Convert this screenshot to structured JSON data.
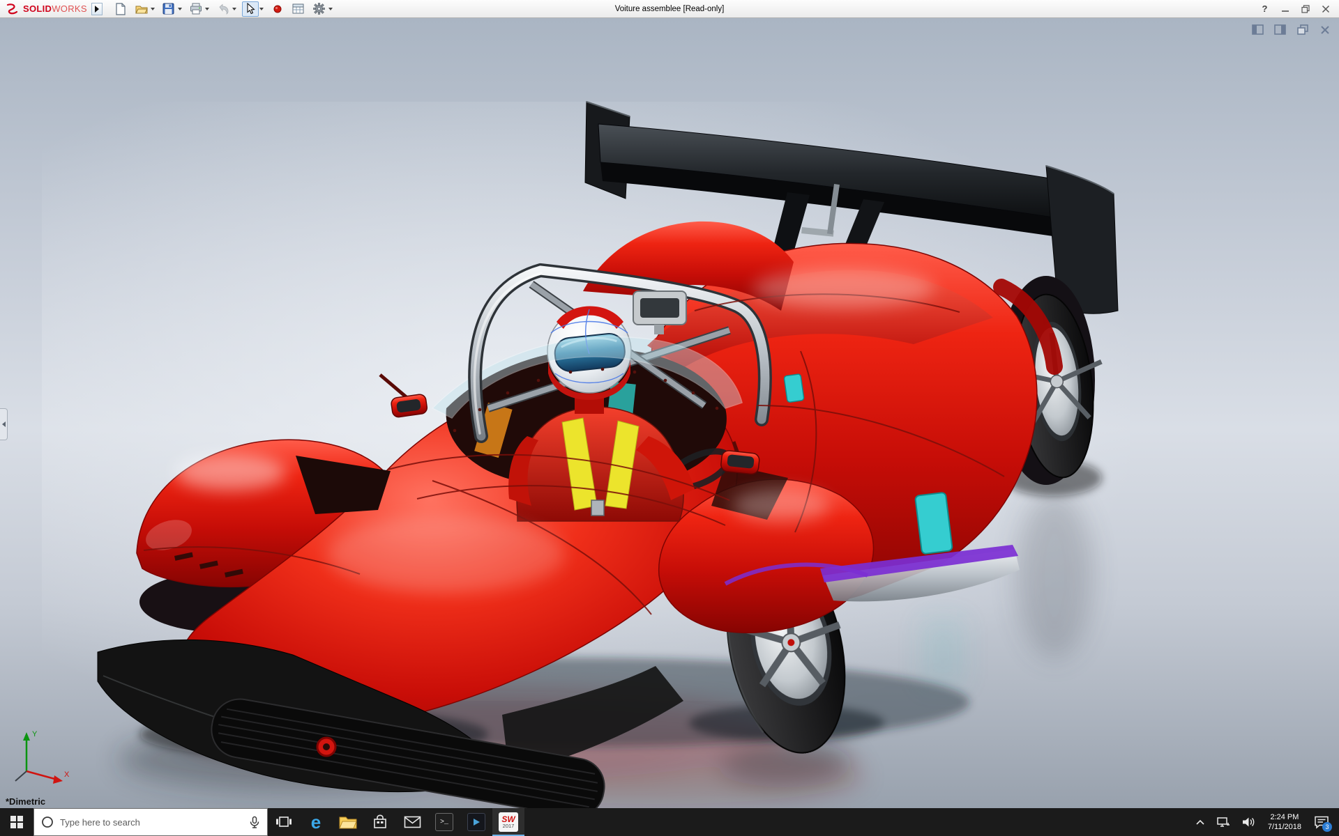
{
  "colors": {
    "accent_red": "#d61310",
    "wing_black": "#141414",
    "accent_cyan": "#35cdd0",
    "accent_purple": "#7b2ed2",
    "harness_yellow": "#ece42c",
    "taskbar_bg": "#1b1b1b",
    "titlebar_bg": "#f2f2f2",
    "active_underline": "#6cb2e8"
  },
  "titlebar": {
    "brand_solid": "SOLID",
    "brand_works": "WORKS",
    "title": "Voiture assemblee [Read-only]",
    "help_glyph": "?",
    "toolbar_icons": [
      "new-document",
      "open",
      "save",
      "print",
      "undo",
      "select-cursor",
      "record-macro",
      "design-table",
      "options-gear"
    ]
  },
  "viewport": {
    "view_label": "*Dimetric",
    "triad": {
      "x": "X",
      "y": "Y"
    }
  },
  "taskbar": {
    "search_placeholder": "Type here to search",
    "edge_glyph": "e",
    "console_glyph": ">_",
    "sw_label": "SW",
    "sw_year": "2017",
    "time": "2:24 PM",
    "date": "7/11/2018",
    "notification_count": "3"
  }
}
